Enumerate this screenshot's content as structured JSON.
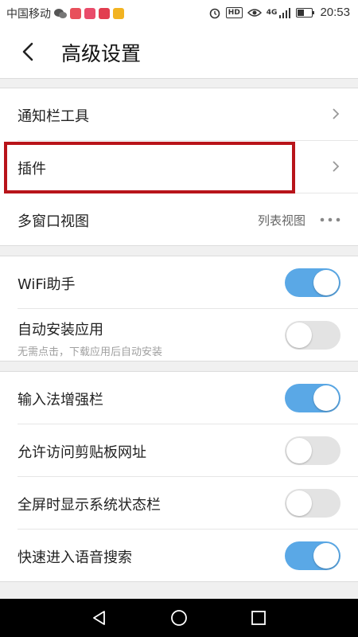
{
  "status_bar": {
    "carrier": "中国移动",
    "network": "4G",
    "hd": "HD",
    "time": "20:53",
    "icons": [
      "wechat-icon",
      "app-icon-1",
      "app-icon-2",
      "app-icon-3",
      "app-icon-4",
      "alarm-icon",
      "eye-icon",
      "signal-icon",
      "battery-icon"
    ]
  },
  "header": {
    "title": "高级设置",
    "back_icon": "chevron-left-icon"
  },
  "group1": {
    "items": [
      {
        "label": "通知栏工具"
      },
      {
        "label": "插件"
      },
      {
        "label": "多窗口视图",
        "value": "列表视图"
      }
    ]
  },
  "group2": {
    "items": [
      {
        "label": "WiFi助手",
        "enabled": true
      },
      {
        "label": "自动安装应用",
        "sublabel": "无需点击，下载应用后自动安装",
        "enabled": false
      }
    ]
  },
  "group3": {
    "items": [
      {
        "label": "输入法增强栏",
        "enabled": true
      },
      {
        "label": "允许访问剪贴板网址",
        "enabled": false
      },
      {
        "label": "全屏时显示系统状态栏",
        "enabled": false
      },
      {
        "label": "快速进入语音搜索",
        "enabled": true
      }
    ]
  },
  "colors": {
    "toggle_on": "#5aa8e6",
    "toggle_off": "#e3e3e3",
    "highlight": "#b8141a"
  },
  "nav_bar": {
    "icons": [
      "back-triangle-icon",
      "home-circle-icon",
      "recents-square-icon"
    ]
  }
}
